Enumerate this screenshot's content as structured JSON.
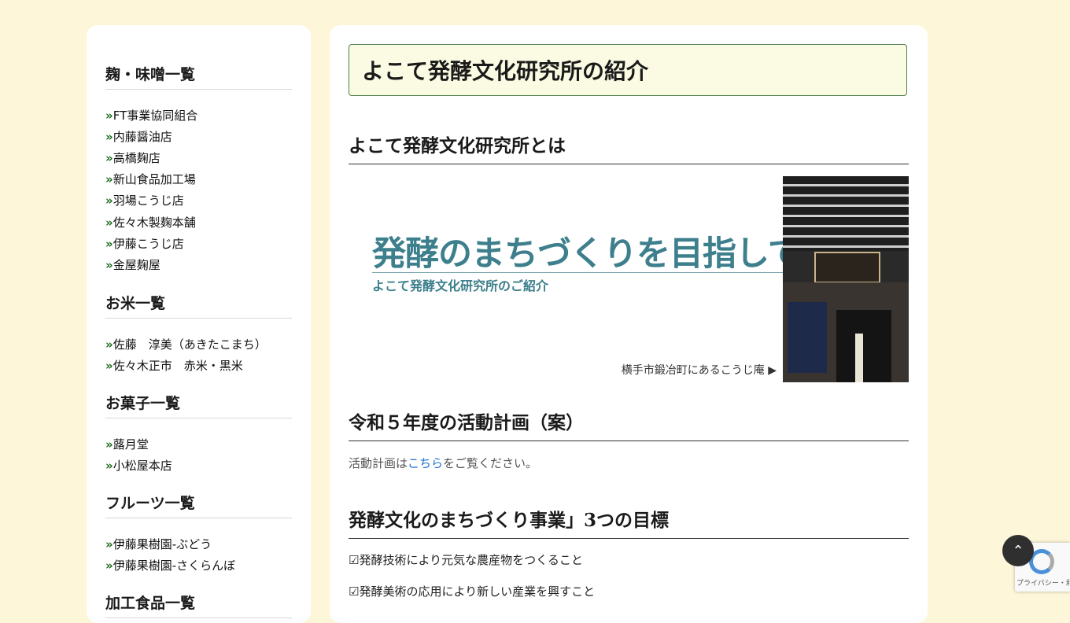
{
  "sidebar": {
    "sections": [
      {
        "heading": "麹・味噌一覧",
        "items": [
          "FT事業協同組合",
          "内藤醤油店",
          "高橋麹店",
          "新山食品加工場",
          "羽場こうじ店",
          "佐々木製麹本舗",
          "伊藤こうじ店",
          "金屋麹屋"
        ]
      },
      {
        "heading": "お米一覧",
        "items": [
          "佐藤　淳美（あきたこまち）",
          "佐々木正市　赤米・黒米"
        ]
      },
      {
        "heading": "お菓子一覧",
        "items": [
          "蕗月堂",
          "小松屋本店"
        ]
      },
      {
        "heading": "フルーツ一覧",
        "items": [
          "伊藤果樹園-ぶどう",
          "伊藤果樹園-さくらんぼ"
        ]
      },
      {
        "heading": "加工食品一覧"
      }
    ],
    "chevron": "»"
  },
  "main": {
    "page_title": "よこて発酵文化研究所の紹介",
    "section1_heading": "よこて発酵文化研究所とは",
    "banner": {
      "headline": "発酵のまちづくりを目指して",
      "subtitle": "よこて発酵文化研究所のご紹介",
      "caption": "横手市鍛冶町にあるこうじ庵 ▶"
    },
    "section2_heading": "令和５年度の活動計画（案）",
    "plan_text_before": "活動計画は",
    "plan_link": "こちら",
    "plan_text_after": "をご覧ください。",
    "section3_heading": "発酵文化のまちづくり事業」3つの目標",
    "goals": [
      "☑発酵技術により元気な農産物をつくること",
      "☑発酵美術の応用により新しい産業を興すこと"
    ]
  },
  "widgets": {
    "to_top": "⌃",
    "recaptcha_text": "プライバシー・利用規約"
  }
}
